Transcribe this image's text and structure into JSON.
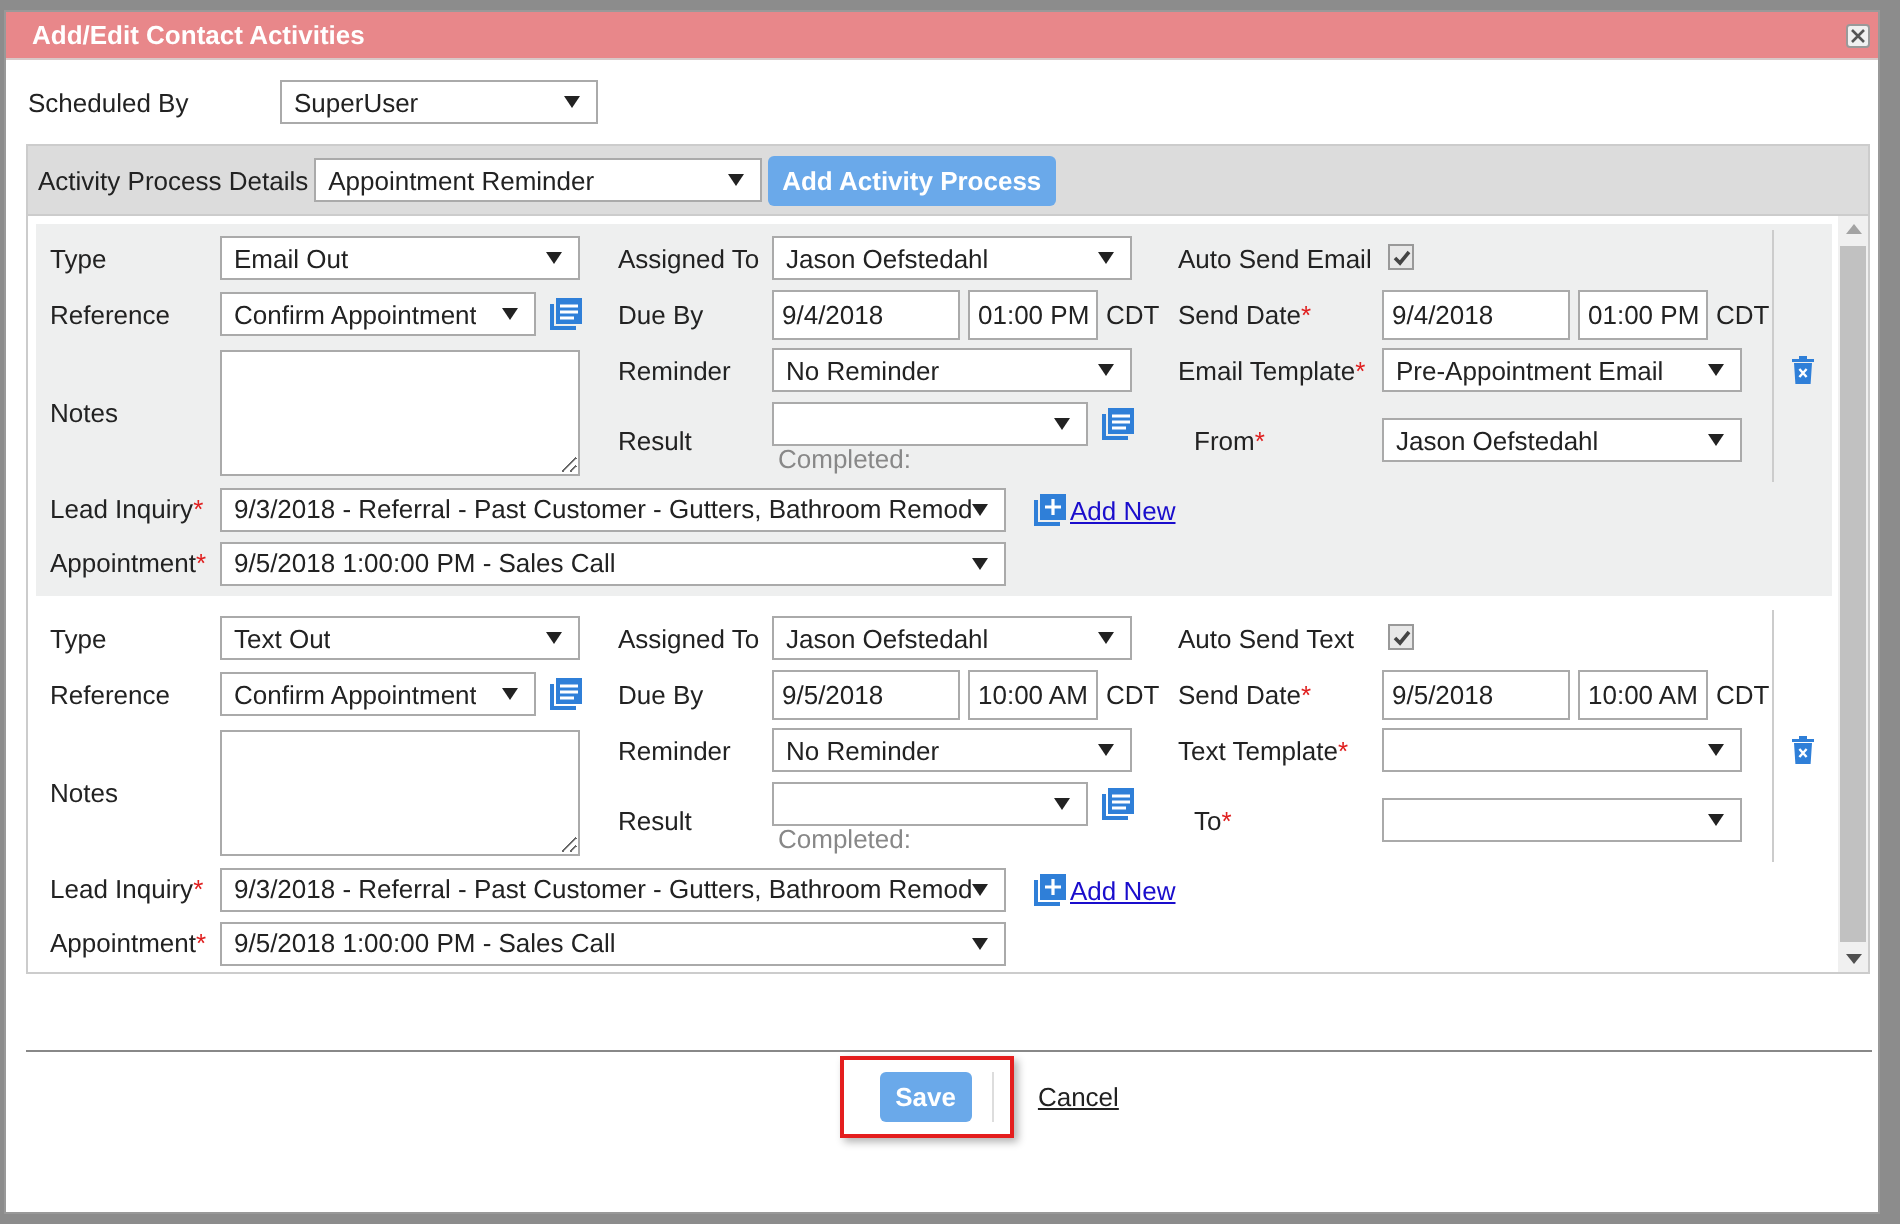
{
  "dialog": {
    "title": "Add/Edit Contact Activities"
  },
  "required_mark": "*",
  "scheduled_by": {
    "label": "Scheduled By",
    "value": "SuperUser"
  },
  "process": {
    "label": "Activity Process Details",
    "value": "Appointment Reminder",
    "button": "Add Activity Process"
  },
  "activities": [
    {
      "shaded": true,
      "type": {
        "label": "Type",
        "value": "Email Out"
      },
      "reference": {
        "label": "Reference",
        "value": "Confirm Appointment"
      },
      "notes": {
        "label": "Notes"
      },
      "assigned_to": {
        "label": "Assigned To",
        "value": "Jason Oefstedahl"
      },
      "due_by": {
        "label": "Due By",
        "date": "9/4/2018",
        "time": "01:00 PM",
        "zone": "CDT"
      },
      "reminder": {
        "label": "Reminder",
        "value": "No Reminder"
      },
      "result": {
        "label": "Result",
        "note": "Completed:"
      },
      "auto_send": {
        "label": "Auto Send Email",
        "checked": true
      },
      "send_date": {
        "label": "Send Date",
        "required": true,
        "date": "9/4/2018",
        "time": "01:00 PM",
        "zone": "CDT"
      },
      "template": {
        "label": "Email Template",
        "required": true,
        "value": "Pre-Appointment Email"
      },
      "recipient": {
        "label": "From",
        "required": true,
        "value": "Jason Oefstedahl"
      },
      "lead_inquiry": {
        "label": "Lead Inquiry",
        "required": true,
        "value": "9/3/2018 - Referral - Past Customer - Gutters, Bathroom Remod"
      },
      "add_new": "Add New",
      "appointment": {
        "label": "Appointment",
        "required": true,
        "value": "9/5/2018 1:00:00 PM - Sales Call"
      }
    },
    {
      "shaded": false,
      "type": {
        "label": "Type",
        "value": "Text Out"
      },
      "reference": {
        "label": "Reference",
        "value": "Confirm Appointment"
      },
      "notes": {
        "label": "Notes"
      },
      "assigned_to": {
        "label": "Assigned To",
        "value": "Jason Oefstedahl"
      },
      "due_by": {
        "label": "Due By",
        "date": "9/5/2018",
        "time": "10:00 AM",
        "zone": "CDT"
      },
      "reminder": {
        "label": "Reminder",
        "value": "No Reminder"
      },
      "result": {
        "label": "Result",
        "note": "Completed:"
      },
      "auto_send": {
        "label": "Auto Send Text",
        "checked": true
      },
      "send_date": {
        "label": "Send Date",
        "required": true,
        "date": "9/5/2018",
        "time": "10:00 AM",
        "zone": "CDT"
      },
      "template": {
        "label": "Text Template",
        "required": true
      },
      "recipient": {
        "label": "To",
        "required": true
      },
      "lead_inquiry": {
        "label": "Lead Inquiry",
        "required": true,
        "value": "9/3/2018 - Referral - Past Customer - Gutters, Bathroom Remod"
      },
      "add_new": "Add New",
      "appointment": {
        "label": "Appointment",
        "required": true,
        "value": "9/5/2018 1:00:00 PM - Sales Call"
      }
    }
  ],
  "buttons": {
    "save": "Save",
    "cancel": "Cancel",
    "save_highlighted": true
  }
}
